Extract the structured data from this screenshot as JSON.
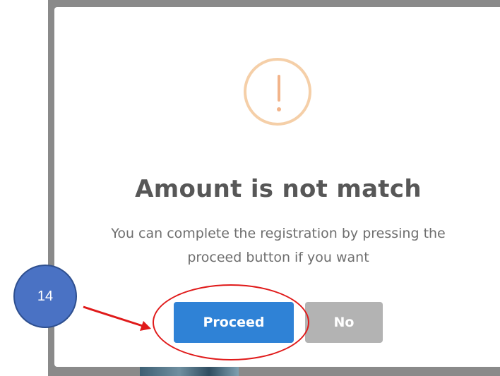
{
  "dialog": {
    "icon": "exclamation-icon",
    "title": "Amount is not match",
    "message_line1": "You can complete the registration by pressing the",
    "message_line2": "proceed button if you want",
    "buttons": {
      "proceed_label": "Proceed",
      "no_label": "No"
    }
  },
  "annotation": {
    "step_number": "14"
  },
  "colors": {
    "proceed_button": "#2f82d6",
    "no_button": "#b3b3b3",
    "warning_icon": "#f2b48a",
    "annotation_badge": "#4a72c4",
    "annotation_highlight": "#e01a1a"
  }
}
